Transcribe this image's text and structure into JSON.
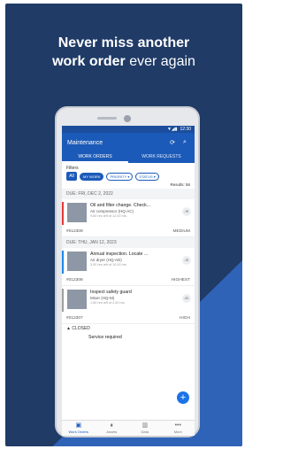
{
  "headline": {
    "line1": "Never miss another",
    "line2_bold": "work order",
    "line2_rest": " ever again"
  },
  "status_bar": {
    "time": "12:30"
  },
  "appbar": {
    "title": "Maintenance"
  },
  "tabs": [
    {
      "label": "WORK ORDERS",
      "active": true
    },
    {
      "label": "WORK REQUESTS",
      "active": false
    }
  ],
  "filters": {
    "label": "Filters",
    "all": "All",
    "chips": [
      "MY WORK",
      "PRIORITY ▾",
      "STATUS ▾"
    ]
  },
  "results": "Results: 56",
  "groups": [
    {
      "due": "DUE: FRI, DEC 2, 2022",
      "orders": [
        {
          "title": "Oil and filter change. Check...",
          "asset": "Air compressor (HQ-AC)",
          "hours": "9.60 hrs left of 12.00 hrs",
          "initials": "JS",
          "id": "#012309",
          "priority": "MEDIUM",
          "color": "#e53935"
        }
      ]
    },
    {
      "due": "DUE: THU, JAN 12, 2023",
      "orders": [
        {
          "title": "Annual inspection. Locate ...",
          "asset": "Air dryer (HQ-AD)",
          "hours": "3.00 hrs left of 10.00 hrs",
          "initials": "JS",
          "id": "#012308",
          "priority": "HIGHEST",
          "color": "#1e88e5"
        },
        {
          "title": "Inspect safety guard",
          "asset": "Mixer (HQ-M)",
          "hours": "1.50 hrs left of 2.00 hrs",
          "initials": "JD",
          "id": "#012307",
          "priority": "HIGH",
          "color": "#9e9e9e"
        }
      ]
    }
  ],
  "closed": {
    "label": "CLOSED",
    "item_title": "Service required"
  },
  "fab": "+",
  "bottom_nav": [
    {
      "label": "Work Orders",
      "icon": "▣",
      "active": true
    },
    {
      "label": "Assets",
      "icon": "⬧",
      "active": false
    },
    {
      "label": "Data",
      "icon": "▥",
      "active": false
    },
    {
      "label": "More",
      "icon": "•••",
      "active": false
    }
  ]
}
